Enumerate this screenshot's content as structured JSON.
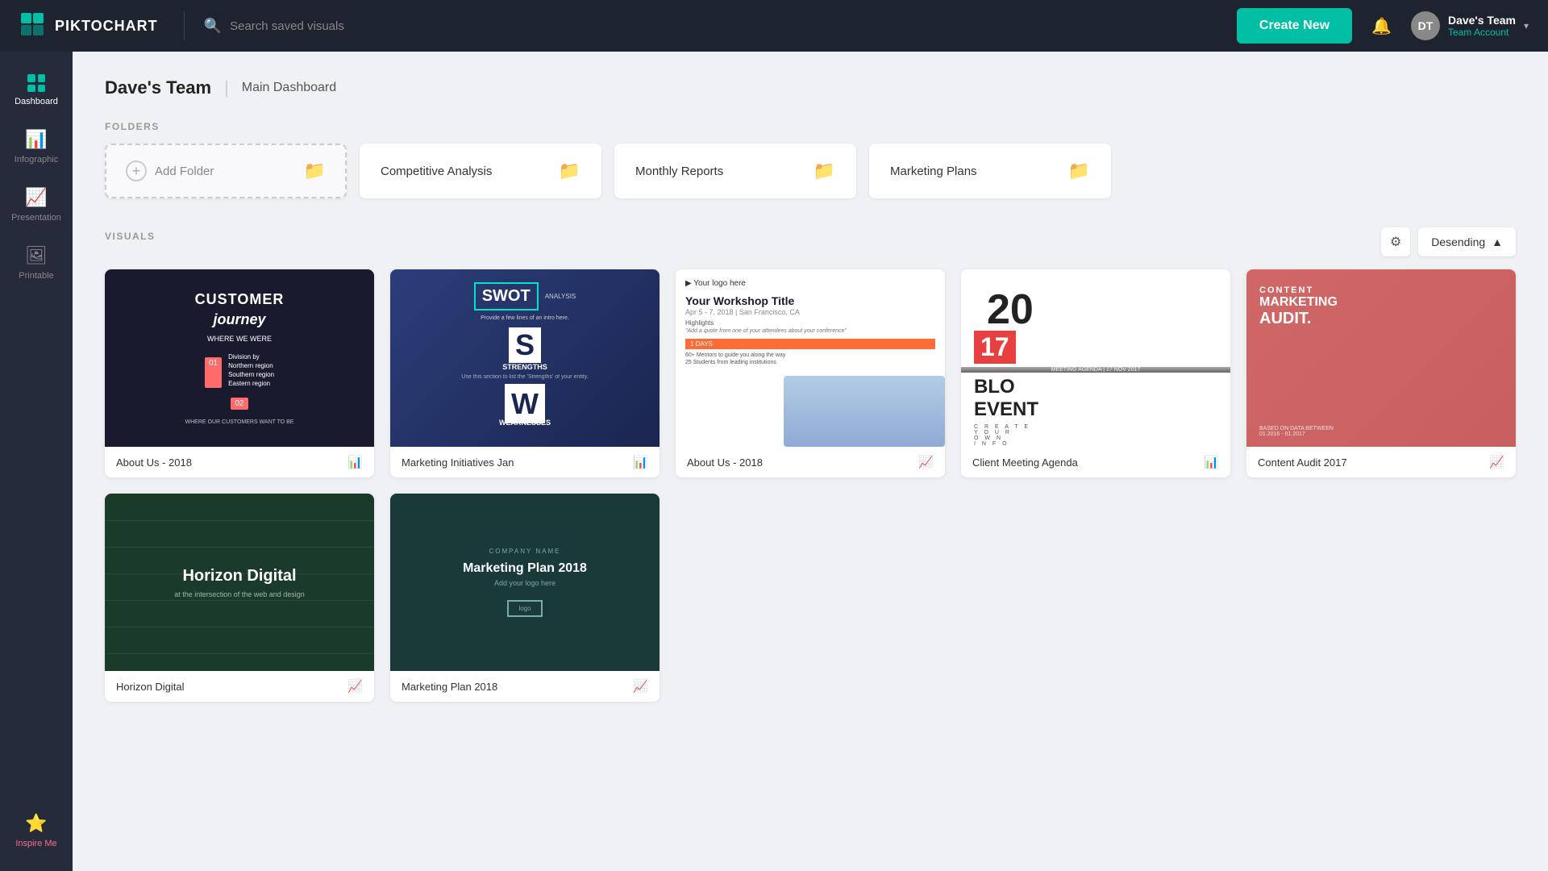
{
  "app": {
    "name": "PIKTOCHART"
  },
  "topnav": {
    "search_placeholder": "Search saved visuals",
    "create_btn_label": "Create New",
    "user": {
      "name": "Dave's Team",
      "role": "Team Account",
      "avatar_initials": "DT"
    }
  },
  "sidebar": {
    "items": [
      {
        "id": "dashboard",
        "label": "Dashboard",
        "icon": "grid",
        "active": true
      },
      {
        "id": "infographic",
        "label": "Infographic",
        "icon": "bar-chart"
      },
      {
        "id": "presentation",
        "label": "Presentation",
        "icon": "trending-up"
      },
      {
        "id": "printable",
        "label": "Printable",
        "icon": "image"
      }
    ],
    "inspire_label": "Inspire Me"
  },
  "content": {
    "title": "Dave's Team",
    "subtitle": "Main Dashboard",
    "folders_section_label": "FOLDERS",
    "visuals_section_label": "VISUALS",
    "add_folder_label": "Add Folder",
    "folders": [
      {
        "id": "competitive-analysis",
        "name": "Competitive Analysis"
      },
      {
        "id": "monthly-reports",
        "name": "Monthly Reports"
      },
      {
        "id": "marketing-plans",
        "name": "Marketing Plans"
      }
    ],
    "sort": {
      "gear_label": "⚙",
      "sort_label": "Desending",
      "sort_arrow": "▲"
    },
    "visuals": [
      {
        "id": "about-us-2018-1",
        "name": "About Us - 2018",
        "type": "infographic",
        "type_icon": "bar-chart"
      },
      {
        "id": "marketing-initiatives",
        "name": "Marketing Initiatives Jan",
        "type": "infographic",
        "type_icon": "bar-chart"
      },
      {
        "id": "about-us-2018-2",
        "name": "About Us - 2018",
        "type": "presentation",
        "type_icon": "trending-up"
      },
      {
        "id": "client-meeting",
        "name": "Client Meeting Agenda",
        "type": "infographic",
        "type_icon": "bar-chart"
      },
      {
        "id": "content-audit",
        "name": "Content Audit 2017",
        "type": "presentation",
        "type_icon": "trending-up"
      },
      {
        "id": "horizon-digital",
        "name": "Horizon Digital",
        "type": "presentation",
        "type_icon": "trending-up"
      },
      {
        "id": "marketing-plan-2018",
        "name": "Marketing Plan 2018",
        "type": "presentation",
        "type_icon": "trending-up"
      }
    ]
  }
}
